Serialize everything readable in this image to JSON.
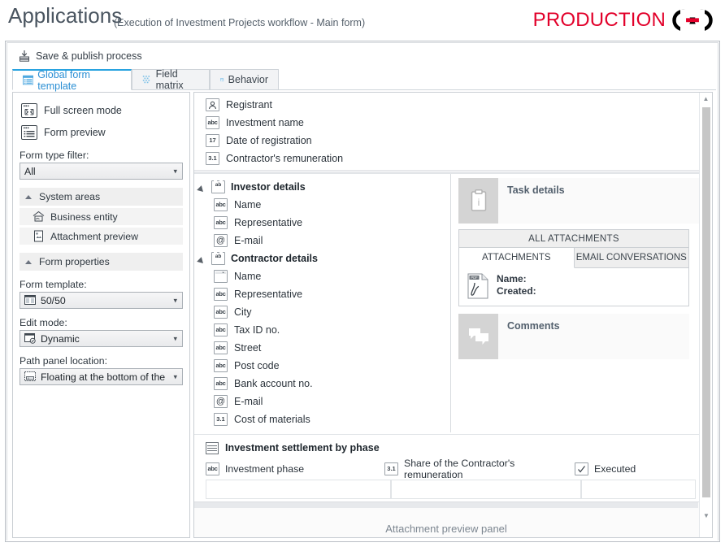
{
  "header": {
    "title": "Applications",
    "subtitle": "(Execution of Investment Projects workflow - Main form)",
    "brand": "PRODUCTION"
  },
  "toolbar": {
    "save_publish": "Save & publish process"
  },
  "tabs": [
    {
      "label": "Global form template",
      "icon": "form-template-icon",
      "active": true
    },
    {
      "label": "Field matrix",
      "icon": "field-matrix-icon",
      "active": false
    },
    {
      "label": "Behavior",
      "icon": "behavior-icon",
      "active": false
    }
  ],
  "sidebar": {
    "buttons": [
      {
        "label": "Full screen mode",
        "icon": "fullscreen-icon"
      },
      {
        "label": "Form preview",
        "icon": "form-preview-icon"
      }
    ],
    "form_type_filter": {
      "label": "Form type filter:",
      "value": "All"
    },
    "system_areas": {
      "label": "System areas",
      "items": [
        {
          "label": "Business entity",
          "icon": "business-entity-icon"
        },
        {
          "label": "Attachment preview",
          "icon": "attachment-preview-icon"
        }
      ]
    },
    "form_properties": {
      "label": "Form properties",
      "fields": [
        {
          "label": "Form template:",
          "value": "50/50",
          "icon": "layout-5050-icon"
        },
        {
          "label": "Edit mode:",
          "value": "Dynamic",
          "icon": "dynamic-icon"
        },
        {
          "label": "Path panel location:",
          "value": "Floating at the bottom of the",
          "icon": "path-panel-icon"
        }
      ]
    }
  },
  "form": {
    "top_fields": [
      {
        "label": "Registrant",
        "icon": "person-icon"
      },
      {
        "label": "Investment name",
        "icon": "abc-icon"
      },
      {
        "label": "Date of registration",
        "icon": "date-icon"
      },
      {
        "label": "Contractor's remuneration",
        "icon": "number-icon"
      }
    ],
    "investor_group": {
      "title": "Investor details",
      "icon": "group-icon",
      "fields": [
        {
          "label": "Name",
          "icon": "abc-icon"
        },
        {
          "label": "Representative",
          "icon": "abc-icon"
        },
        {
          "label": "E-mail",
          "icon": "email-icon"
        }
      ]
    },
    "contractor_group": {
      "title": "Contractor details",
      "icon": "group-icon",
      "fields": [
        {
          "label": "Name",
          "icon": "dropdown-icon"
        },
        {
          "label": "Representative",
          "icon": "abc-icon"
        },
        {
          "label": "City",
          "icon": "abc-icon"
        },
        {
          "label": "Tax ID no.",
          "icon": "abc-icon"
        },
        {
          "label": "Street",
          "icon": "abc-icon"
        },
        {
          "label": "Post code",
          "icon": "abc-icon"
        },
        {
          "label": "Bank account no.",
          "icon": "abc-icon"
        },
        {
          "label": "E-mail",
          "icon": "email-icon"
        },
        {
          "label": "Cost of materials",
          "icon": "number-icon"
        }
      ]
    },
    "task_details": {
      "title": "Task details",
      "icon": "clipboard-info-icon",
      "all_attachments": "ALL ATTACHMENTS",
      "tabs": [
        {
          "label": "ATTACHMENTS",
          "active": true
        },
        {
          "label": "EMAIL CONVERSATIONS",
          "active": false
        }
      ],
      "attachment": {
        "icon": "pdf-icon",
        "name_label": "Name:",
        "created_label": "Created:"
      }
    },
    "comments": {
      "title": "Comments",
      "icon": "comments-icon"
    },
    "table": {
      "title": "Investment settlement by phase",
      "icon": "table-icon",
      "columns": [
        {
          "label": "Investment phase",
          "icon": "abc-icon"
        },
        {
          "label": "Share of the Contractor's remuneration",
          "icon": "number-icon"
        },
        {
          "label": "Executed",
          "icon": "checkbox-icon"
        }
      ],
      "rows": [
        [
          "",
          "",
          ""
        ]
      ]
    },
    "preview_panel": {
      "label": "Attachment preview panel"
    }
  },
  "colors": {
    "brand_red": "#e2002a",
    "accent_blue": "#29a3e0",
    "tab_text_active": "#2b8fd4",
    "panel_grey": "#d4d4d4"
  }
}
